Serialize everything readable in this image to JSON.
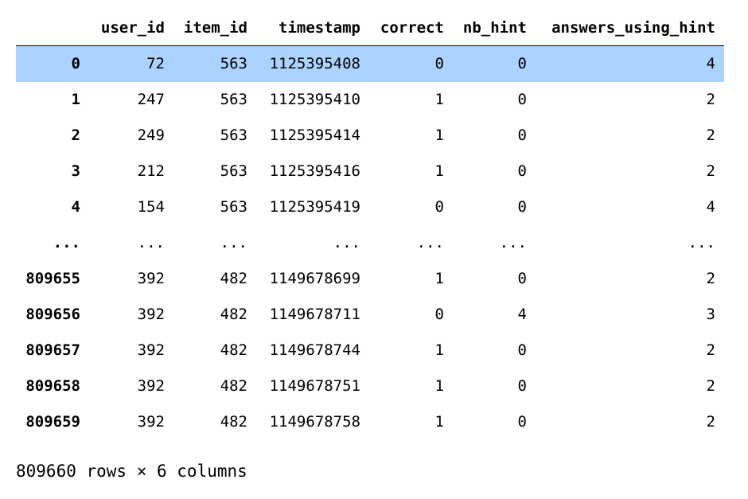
{
  "dataframe": {
    "columns": [
      "user_id",
      "item_id",
      "timestamp",
      "correct",
      "nb_hint",
      "answers_using_hint"
    ],
    "index_header": "",
    "selected_row": 0,
    "rows": [
      {
        "index": "0",
        "cells": [
          "72",
          "563",
          "1125395408",
          "0",
          "0",
          "4"
        ]
      },
      {
        "index": "1",
        "cells": [
          "247",
          "563",
          "1125395410",
          "1",
          "0",
          "2"
        ]
      },
      {
        "index": "2",
        "cells": [
          "249",
          "563",
          "1125395414",
          "1",
          "0",
          "2"
        ]
      },
      {
        "index": "3",
        "cells": [
          "212",
          "563",
          "1125395416",
          "1",
          "0",
          "2"
        ]
      },
      {
        "index": "4",
        "cells": [
          "154",
          "563",
          "1125395419",
          "0",
          "0",
          "4"
        ]
      },
      {
        "index": "...",
        "cells": [
          "...",
          "...",
          "...",
          "...",
          "...",
          "..."
        ]
      },
      {
        "index": "809655",
        "cells": [
          "392",
          "482",
          "1149678699",
          "1",
          "0",
          "2"
        ]
      },
      {
        "index": "809656",
        "cells": [
          "392",
          "482",
          "1149678711",
          "0",
          "4",
          "3"
        ]
      },
      {
        "index": "809657",
        "cells": [
          "392",
          "482",
          "1149678744",
          "1",
          "0",
          "2"
        ]
      },
      {
        "index": "809658",
        "cells": [
          "392",
          "482",
          "1149678751",
          "1",
          "0",
          "2"
        ]
      },
      {
        "index": "809659",
        "cells": [
          "392",
          "482",
          "1149678758",
          "1",
          "0",
          "2"
        ]
      }
    ],
    "shape_text": "809660 rows × 6 columns"
  },
  "colors": {
    "selected_row_bg": "#abd3ff",
    "text": "#000000",
    "background": "#ffffff"
  }
}
